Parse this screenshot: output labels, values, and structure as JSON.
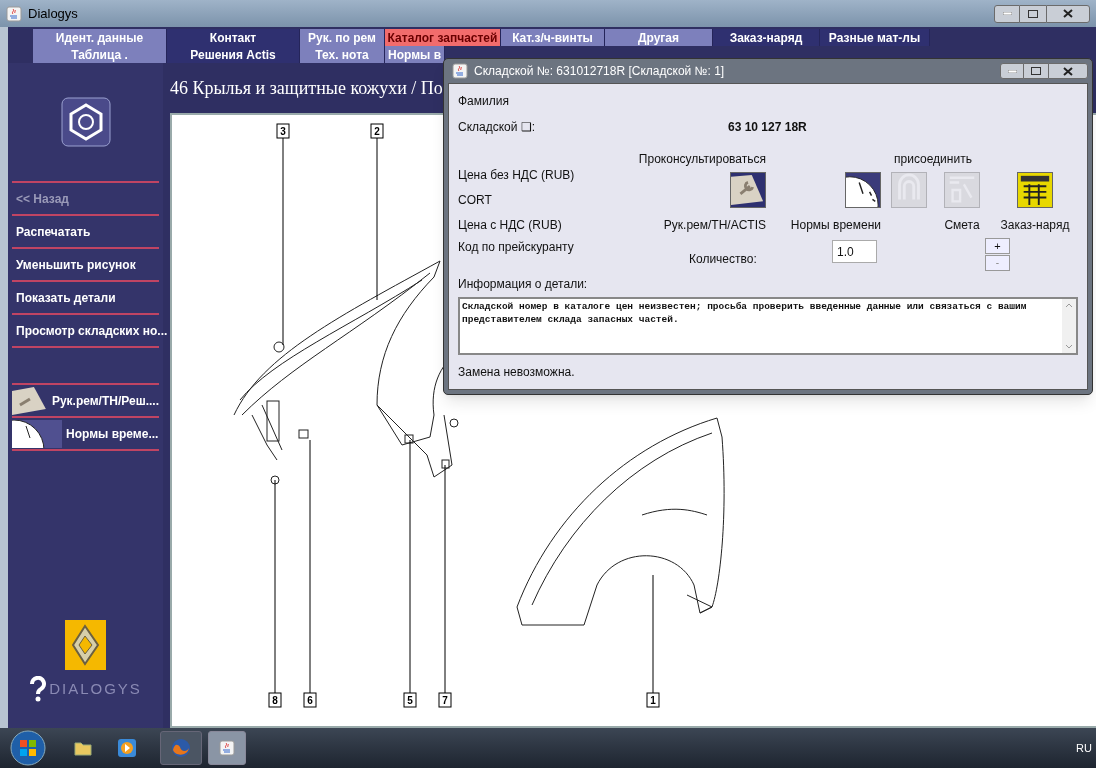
{
  "window": {
    "title": "Dialogys"
  },
  "tabs_row1": [
    {
      "label": "Идент. данные",
      "selected": false,
      "kind": "light"
    },
    {
      "label": "Контакт",
      "selected": false,
      "kind": "dark"
    },
    {
      "label": "Рук. по рем",
      "selected": false,
      "kind": "light"
    },
    {
      "label": "Каталог запчастей",
      "selected": true
    },
    {
      "label": "Кат.з/ч-винты",
      "selected": false,
      "kind": "light"
    },
    {
      "label": "Другая",
      "selected": false,
      "kind": "light"
    },
    {
      "label": "Заказ-наряд",
      "selected": false,
      "kind": "dark"
    },
    {
      "label": "Разные мат-лы",
      "selected": false,
      "kind": "dark"
    }
  ],
  "tabs_row2": [
    {
      "label": "Таблица .",
      "selected": false,
      "kind": "light"
    },
    {
      "label": "Решения Actis",
      "selected": false,
      "kind": "dark"
    },
    {
      "label": "Тех. нота",
      "selected": false,
      "kind": "light"
    },
    {
      "label": "Нормы в",
      "selected": false,
      "kind": "light"
    }
  ],
  "sidebar": {
    "items": [
      {
        "label": "<< Назад",
        "disabled": true
      },
      {
        "label": "Распечатать",
        "disabled": false
      },
      {
        "label": "Уменьшить рисунок",
        "disabled": false
      },
      {
        "label": "Показать детали",
        "disabled": false
      },
      {
        "label": "Просмотр складских но...",
        "disabled": false
      }
    ],
    "tools": [
      {
        "label": "Рук.рем/TH/Реш....",
        "kind": "manual"
      },
      {
        "label": "Нормы време...",
        "kind": "clock"
      }
    ],
    "brand": "DIALOGYS"
  },
  "page_title": "46 Крылья и защитные кожухи / По",
  "diagram": {
    "callouts": [
      "3",
      "2",
      "8",
      "6",
      "5",
      "7",
      "1"
    ]
  },
  "dialog": {
    "title": "Складской №: 631012718R [Складской №: 1]",
    "family_label": "Фамилия",
    "part_label": "Складской ❑:",
    "part_number": "63 10 127 18R",
    "left_labels": [
      "Цена без НДС (RUB)",
      "CORT",
      "Цена с НДС (RUB)"
    ],
    "consult_label": "Проконсультироваться",
    "attach_label": "присоединить",
    "actions": [
      {
        "kind": "manual",
        "label": "Рук.рем/TH/ACTIS",
        "disabled": false
      },
      {
        "kind": "clock",
        "label": "Нормы времени",
        "disabled": false
      },
      {
        "kind": "module",
        "disabled": true
      },
      {
        "kind": "estimate",
        "label": "Смета",
        "disabled": true
      },
      {
        "kind": "order",
        "label": "Заказ-наряд",
        "disabled": false
      }
    ],
    "price_code_label": "Код по прейскуранту",
    "quantity_label": "Количество:",
    "quantity": "1.0",
    "plus": "+",
    "minus": "-",
    "info_label": "Информация о детали:",
    "info_text": "Складской номер в каталоге цен неизвестен; просьба проверить введенные данные или связаться с вашим представителем склада запасных частей.",
    "status": "Замена невозможна."
  },
  "taskbar": {
    "language": "RU"
  }
}
